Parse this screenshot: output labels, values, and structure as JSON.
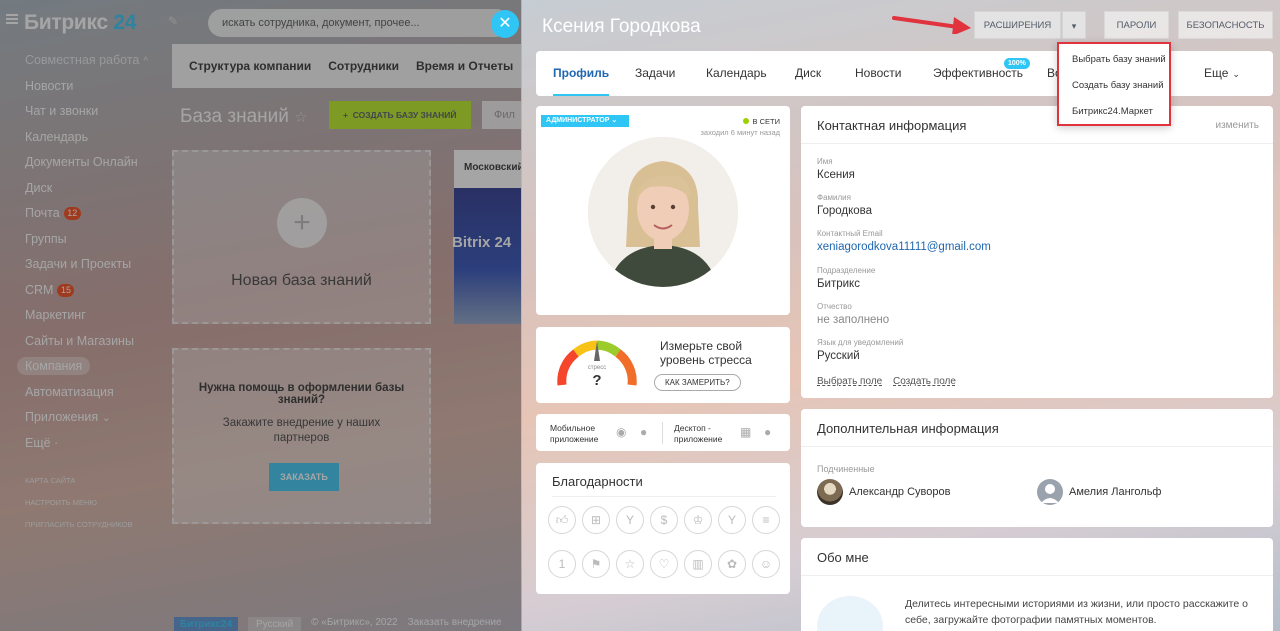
{
  "header": {
    "logo_text": "Битрикс",
    "logo_num": "24",
    "search_placeholder": "искать сотрудника, документ, прочее..."
  },
  "menu": {
    "group_label": "Совместная работа",
    "items": [
      {
        "label": "Новости"
      },
      {
        "label": "Чат и звонки"
      },
      {
        "label": "Календарь"
      },
      {
        "label": "Документы Онлайн"
      },
      {
        "label": "Диск"
      },
      {
        "label": "Почта",
        "counter": "12"
      },
      {
        "label": "Группы"
      },
      {
        "label": "Задачи и Проекты"
      },
      {
        "label": "CRM",
        "counter": "15"
      },
      {
        "label": "Маркетинг"
      },
      {
        "label": "Сайты и Магазины"
      },
      {
        "label": "Компания"
      },
      {
        "label": "Автоматизация"
      },
      {
        "label": "Приложения"
      },
      {
        "label": "Ещё"
      }
    ],
    "small_links": [
      "КАРТА САЙТА",
      "НАСТРОИТЬ МЕНЮ",
      "ПРИГЛАСИТЬ СОТРУДНИКОВ"
    ]
  },
  "background_page": {
    "subnav": [
      "Структура компании",
      "Сотрудники",
      "Время и Отчеты"
    ],
    "title": "База знаний",
    "create_button": "СОЗДАТЬ БАЗУ ЗНАНИЙ",
    "filter_placeholder": "Фил",
    "new_kb_label": "Новая база знаний",
    "help_title": "Нужна помощь в оформлении базы знаний?",
    "help_text": "Закажите внедрение у наших партнеров",
    "order_button": "ЗАКАЗАТЬ",
    "kb_card_name": "Московский",
    "kb_card_img_text": "Bitrix 24",
    "footer": {
      "logo": "Битрикс24",
      "lang": "Русский",
      "copy": "© «Битрикс», 2022",
      "order": "Заказать внедрение"
    }
  },
  "slider": {
    "title": "Ксения Городкова",
    "buttons": {
      "extensions": "РАСШИРЕНИЯ",
      "passwords": "ПАРОЛИ",
      "security": "БЕЗОПАСНОСТЬ"
    },
    "dropdown": [
      "Выбрать базу знаний",
      "Создать базу знаний",
      "Битрикс24.Маркет"
    ],
    "tabs": [
      "Профиль",
      "Задачи",
      "Календарь",
      "Диск",
      "Новости",
      "Эффективность",
      "Во",
      "Еще"
    ],
    "efficiency_badge": "100%",
    "profile": {
      "role": "АДМИНИСТРАТОР",
      "status": "В СЕТИ",
      "last_seen": "заходил 6 минут назад"
    },
    "stress": {
      "gauge_label": "стресс",
      "gauge_value": "?",
      "text": "Измерьте свой уровень стресса",
      "button": "КАК ЗАМЕРИТЬ?"
    },
    "apps": {
      "mobile": "Мобильное приложение",
      "desktop": "Десктоп - приложение"
    },
    "thanks_title": "Благодарности",
    "contact": {
      "title": "Контактная информация",
      "edit": "изменить",
      "fields": [
        {
          "label": "Имя",
          "value": "Ксения"
        },
        {
          "label": "Фамилия",
          "value": "Городкова"
        },
        {
          "label": "Контактный Email",
          "value": "xeniagorodkova11111@gmail.com"
        },
        {
          "label": "Подразделение",
          "value": "Битрикс"
        },
        {
          "label": "Отчество",
          "value": "не заполнено"
        },
        {
          "label": "Язык для уведомлений",
          "value": "Русский"
        }
      ],
      "choose_field": "Выбрать поле",
      "create_field": "Создать поле"
    },
    "extra": {
      "title": "Дополнительная информация",
      "subordinates_label": "Подчиненные",
      "subordinates": [
        "Александр Суворов",
        "Амелия Лангольф"
      ]
    },
    "about": {
      "title": "Обо мне",
      "text": "Делитесь интересными историями из жизни, или просто расскажите о себе, загружайте фотографии памятных моментов."
    }
  },
  "colors": {
    "accent": "#2fc6f6",
    "link": "#2067b0",
    "create_button": "#bbed21",
    "highlight": "#e0333d"
  }
}
